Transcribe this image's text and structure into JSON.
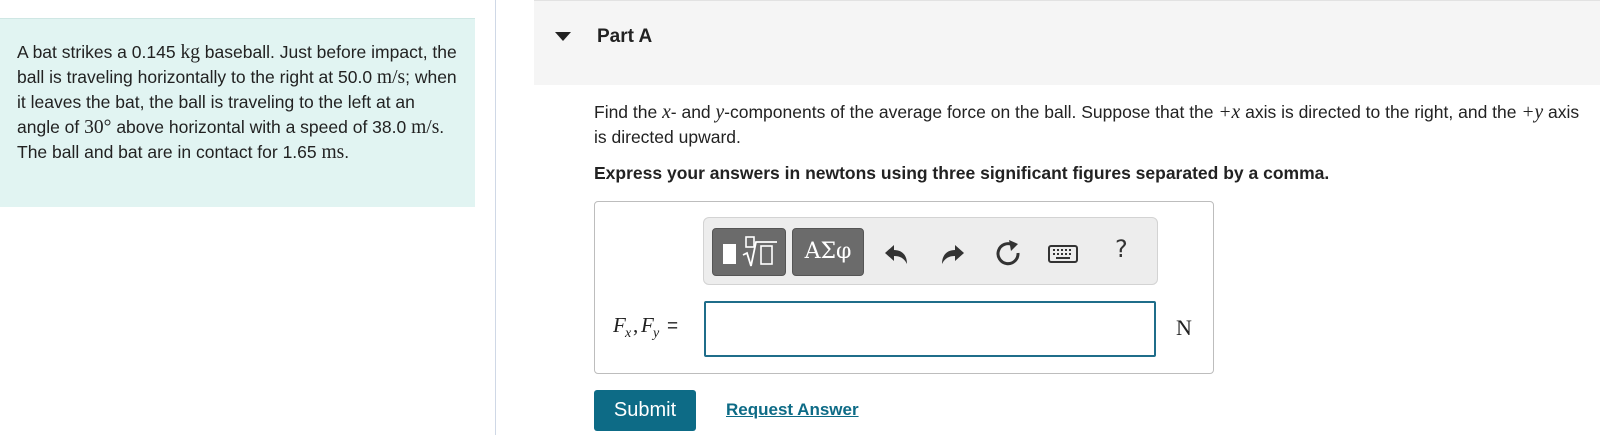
{
  "problem": {
    "p1": "A bat strikes a 0.145 ",
    "u1": "kg",
    "p2": " baseball. Just before impact, the ball is traveling horizontally to the right at 50.0 ",
    "u2": "m/s",
    "p3": "; when it leaves the bat, the ball is traveling to the left at an angle of ",
    "angle": "30°",
    "p4": " above horizontal with a speed of 38.0 ",
    "u3": "m/s",
    "p5": ". The ball and bat are in contact for 1.65 ",
    "u4": "ms",
    "p6": "."
  },
  "part": {
    "title": "Part A"
  },
  "question": {
    "q1": "Find the ",
    "x": "x",
    "q2": "- and ",
    "y": "y",
    "q3": "-components of the average force on the ball. Suppose that the ",
    "plus_x": "+x",
    "q4": " axis is directed to the right, and the ",
    "plus_y": "+y",
    "q5": " axis is directed upward."
  },
  "instruction": "Express your answers in newtons using three significant figures separated by a comma.",
  "toolbar": {
    "symbols_label": "ΑΣφ",
    "help_label": "?",
    "icons": [
      "templates-icon",
      "greek-symbols-icon",
      "undo-icon",
      "redo-icon",
      "reset-icon",
      "keyboard-icon",
      "help-icon"
    ]
  },
  "answer": {
    "label": "Fx, Fy =",
    "value": "",
    "unit": "N"
  },
  "actions": {
    "submit_label": "Submit",
    "request_label": "Request Answer"
  },
  "colors": {
    "problem_bg": "#e1f4f2",
    "accent": "#0d6b86",
    "input_border": "#1f6d8a",
    "toolbar_button": "#6b6b6b"
  }
}
